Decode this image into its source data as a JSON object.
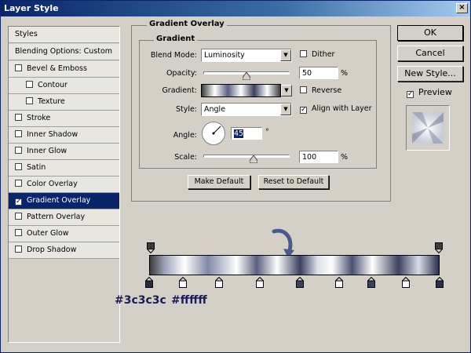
{
  "window": {
    "title": "Layer Style",
    "close": "×"
  },
  "styles_list": {
    "header_items": [
      "Styles",
      "Blending Options: Custom"
    ],
    "items": [
      {
        "label": "Bevel & Emboss",
        "checked": false,
        "indent": false
      },
      {
        "label": "Contour",
        "checked": false,
        "indent": true
      },
      {
        "label": "Texture",
        "checked": false,
        "indent": true
      },
      {
        "label": "Stroke",
        "checked": false,
        "indent": false
      },
      {
        "label": "Inner Shadow",
        "checked": false,
        "indent": false
      },
      {
        "label": "Inner Glow",
        "checked": false,
        "indent": false
      },
      {
        "label": "Satin",
        "checked": false,
        "indent": false
      },
      {
        "label": "Color Overlay",
        "checked": false,
        "indent": false
      },
      {
        "label": "Gradient Overlay",
        "checked": true,
        "indent": false,
        "selected": true
      },
      {
        "label": "Pattern Overlay",
        "checked": false,
        "indent": false
      },
      {
        "label": "Outer Glow",
        "checked": false,
        "indent": false
      },
      {
        "label": "Drop Shadow",
        "checked": false,
        "indent": false
      }
    ]
  },
  "panel": {
    "section_title": "Gradient Overlay",
    "group_title": "Gradient",
    "blend_mode_label": "Blend Mode:",
    "blend_mode_value": "Luminosity",
    "dither_label": "Dither",
    "dither_checked": false,
    "opacity_label": "Opacity:",
    "opacity_value": "50",
    "opacity_unit": "%",
    "opacity_percent": 50,
    "gradient_label": "Gradient:",
    "reverse_label": "Reverse",
    "reverse_checked": false,
    "style_label": "Style:",
    "style_value": "Angle",
    "align_label": "Align with Layer",
    "align_checked": true,
    "angle_label": "Angle:",
    "angle_value": "45",
    "angle_unit": "°",
    "scale_label": "Scale:",
    "scale_value": "100",
    "scale_unit": "%",
    "scale_percent": 100,
    "make_default": "Make Default",
    "reset_default": "Reset to Default"
  },
  "side_buttons": {
    "ok": "OK",
    "cancel": "Cancel",
    "new_style": "New Style...",
    "preview_label": "Preview",
    "preview_checked": true
  },
  "gradient_editor": {
    "color_labels": [
      "#3c3c3c",
      "#ffffff"
    ]
  },
  "colors": {
    "title_bar": "#0a246a",
    "selection": "#0a246a",
    "dialog_bg": "#d4d0c8",
    "hex_text": "#1b1b5c"
  }
}
